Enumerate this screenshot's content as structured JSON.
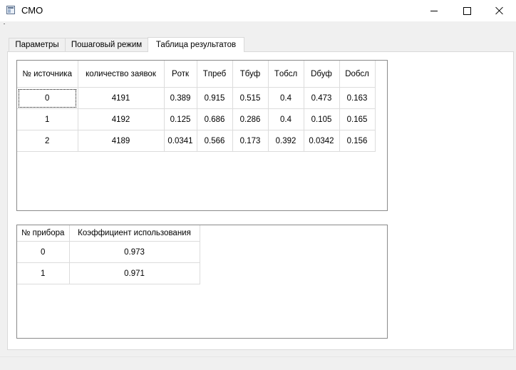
{
  "window": {
    "title": "СМО"
  },
  "tabs": [
    "Параметры",
    "Пошаговый режим",
    "Таблица результатов"
  ],
  "active_tab": "Таблица результатов",
  "sources_table": {
    "headers": [
      "№ источника",
      "количество заявок",
      "Pотк",
      "Tпреб",
      "Tбуф",
      "Tобсл",
      "Dбуф",
      "Dобсл"
    ],
    "rows": [
      [
        "0",
        "4191",
        "0.389",
        "0.915",
        "0.515",
        "0.4",
        "0.473",
        "0.163"
      ],
      [
        "1",
        "4192",
        "0.125",
        "0.686",
        "0.286",
        "0.4",
        "0.105",
        "0.165"
      ],
      [
        "2",
        "4189",
        "0.0341",
        "0.566",
        "0.173",
        "0.392",
        "0.0342",
        "0.156"
      ]
    ]
  },
  "devices_table": {
    "headers": [
      "№ прибора",
      "Коэффициент использования"
    ],
    "rows": [
      [
        "0",
        "0.973"
      ],
      [
        "1",
        "0.971"
      ]
    ]
  }
}
